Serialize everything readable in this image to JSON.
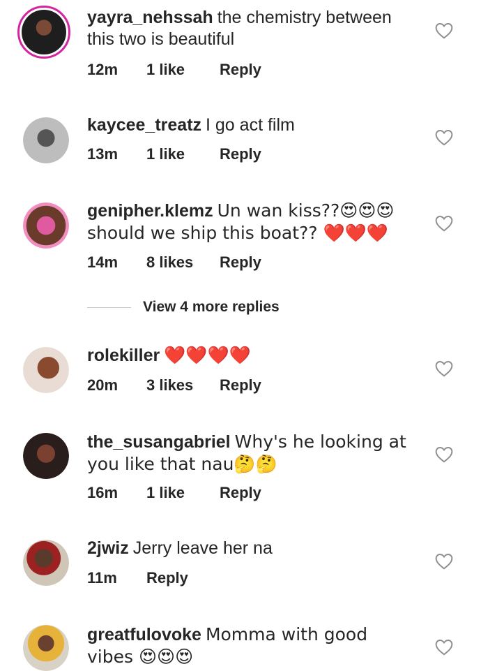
{
  "comments": [
    {
      "username": "yayra_nehssah",
      "text": "the chemistry between this two is beautiful",
      "time": "12m",
      "likes": "1 like",
      "reply": "Reply",
      "avatar_color": "#2b2b2b"
    },
    {
      "username": "kaycee_treatz",
      "text": "I go act film",
      "time": "13m",
      "likes": "1 like",
      "reply": "Reply",
      "avatar_color": "#9a9a9a"
    },
    {
      "username": "genipher.klemz",
      "text": "Un wan kiss??😍😍😍 should we ship this boat?? ❤️❤️❤️",
      "time": "14m",
      "likes": "8 likes",
      "reply": "Reply",
      "avatar_color": "#c0507a"
    },
    {
      "username": "rolekiller",
      "text": "❤️❤️❤️❤️",
      "time": "20m",
      "likes": "3 likes",
      "reply": "Reply",
      "avatar_color": "#6b3a28"
    },
    {
      "username": "the_susangabriel",
      "text": "Why's he looking at you like that nau🤔🤔",
      "time": "16m",
      "likes": "1 like",
      "reply": "Reply",
      "avatar_color": "#3a2a28"
    },
    {
      "username": "2jwiz",
      "text": "Jerry leave her na",
      "time": "11m",
      "likes": "",
      "reply": "Reply",
      "avatar_color": "#7a5a45"
    },
    {
      "username": "greatfulovoke",
      "text": "Momma with good vibes 😍😍😍",
      "time": "",
      "likes": "",
      "reply": "",
      "avatar_color": "#c99a3a"
    }
  ],
  "view_more_replies": "View 4 more replies",
  "icons": {
    "like": "heart-outline-icon"
  },
  "colors": {
    "story_ring": "#d6249f",
    "text": "#262626",
    "divider": "#c7c7c7"
  }
}
